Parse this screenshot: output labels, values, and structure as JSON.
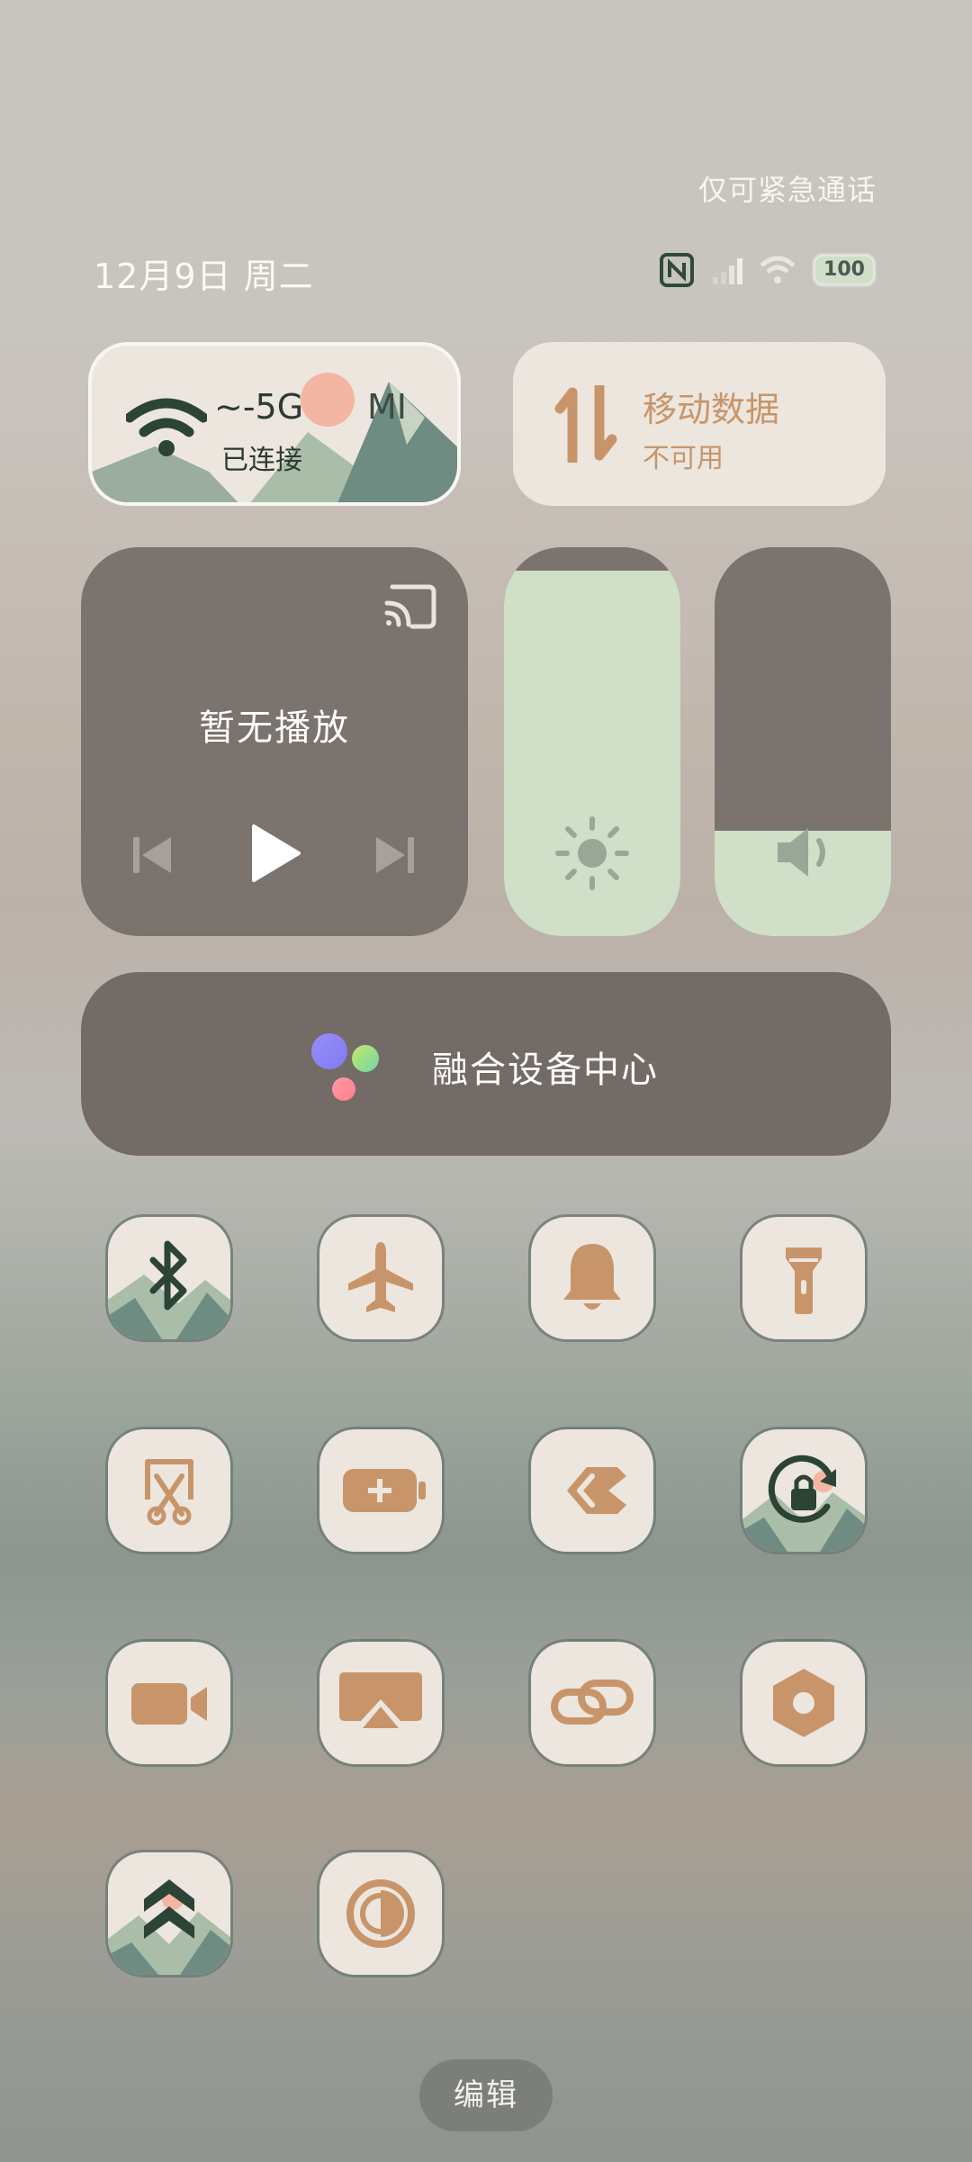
{
  "status_bar": {
    "emergency_text": "仅可紧急通话",
    "date": "12月9日 周二",
    "battery": "100"
  },
  "wifi_tile": {
    "title": "~-5G",
    "title_suffix": "MI",
    "status": "已连接"
  },
  "mobile_tile": {
    "title": "移动数据",
    "status": "不可用"
  },
  "media": {
    "label": "暂无播放"
  },
  "sliders": {
    "brightness": 0.94,
    "volume": 0.27
  },
  "device_center": {
    "label": "融合设备中心"
  },
  "colors": {
    "accent": "#c8956a",
    "tile_bg": "#ece6de",
    "dark_green": "#2f4a3a",
    "panel": "#7a736e",
    "slider_fill": "#cfdfc8"
  },
  "edit": {
    "label": "编辑"
  }
}
